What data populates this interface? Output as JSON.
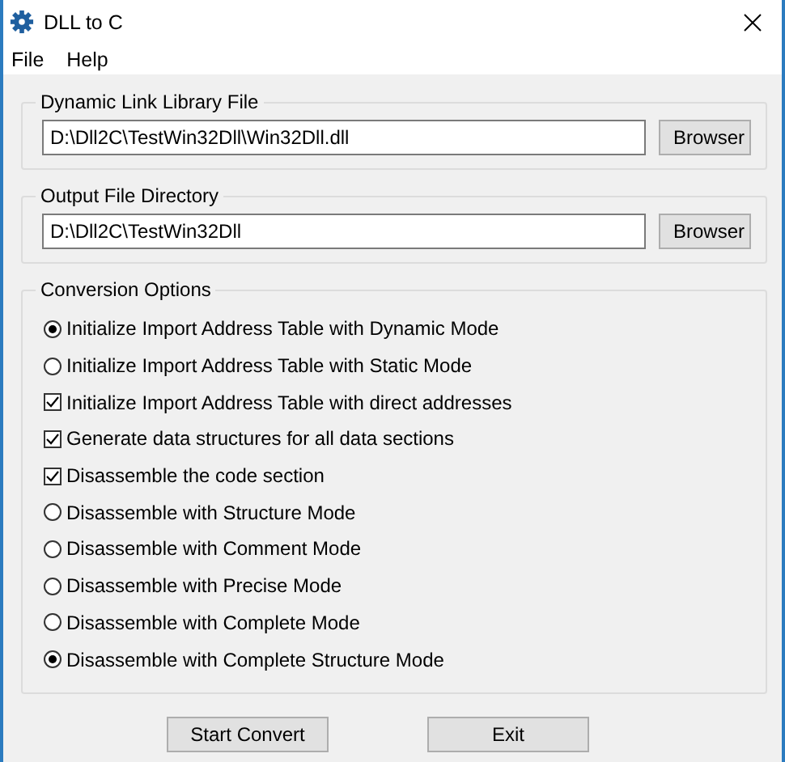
{
  "window": {
    "title": "DLL to C"
  },
  "menu": [
    "File",
    "Help"
  ],
  "dll_group": {
    "title": "Dynamic Link Library File",
    "value": "D:\\Dll2C\\TestWin32Dll\\Win32Dll.dll",
    "button": "Browser"
  },
  "output_group": {
    "title": "Output File Directory",
    "value": "D:\\Dll2C\\TestWin32Dll",
    "button": "Browser"
  },
  "options_group": {
    "title": "Conversion Options",
    "options": [
      {
        "kind": "radio",
        "label": "Initialize Import Address Table with Dynamic Mode",
        "selected": true
      },
      {
        "kind": "radio",
        "label": "Initialize Import Address Table with Static Mode",
        "selected": false
      },
      {
        "kind": "checkbox",
        "label": "Initialize Import Address Table with direct addresses",
        "checked": true
      },
      {
        "kind": "checkbox",
        "label": "Generate data structures for all data sections",
        "checked": true
      },
      {
        "kind": "checkbox",
        "label": "Disassemble the code section",
        "checked": true
      },
      {
        "kind": "radio",
        "label": "Disassemble with Structure Mode",
        "selected": false
      },
      {
        "kind": "radio",
        "label": "Disassemble with Comment Mode",
        "selected": false
      },
      {
        "kind": "radio",
        "label": "Disassemble with Precise Mode",
        "selected": false
      },
      {
        "kind": "radio",
        "label": "Disassemble with Complete Mode",
        "selected": false
      },
      {
        "kind": "radio",
        "label": "Disassemble with Complete Structure Mode",
        "selected": true
      }
    ]
  },
  "buttons": [
    "Start Convert",
    "Exit"
  ]
}
